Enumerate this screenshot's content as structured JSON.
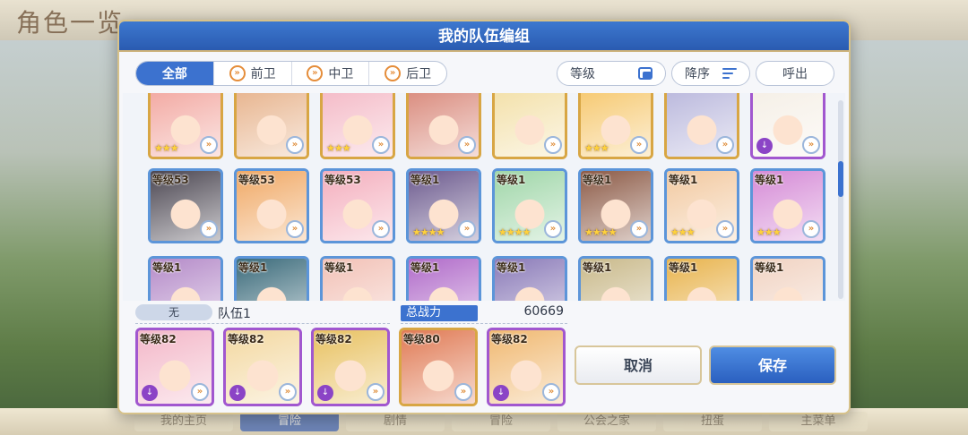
{
  "background": {
    "title": "角色一览",
    "bottom_tabs": [
      "我的主页",
      "冒险",
      "剧情",
      "冒险",
      "公会之家",
      "扭蛋",
      "主菜单"
    ]
  },
  "dialog": {
    "title": "我的队伍编组",
    "filter_tabs": [
      "全部",
      "前卫",
      "中卫",
      "后卫"
    ],
    "sort_field": "等级",
    "sort_order": "降序",
    "call_button": "呼出"
  },
  "grid": [
    {
      "level": "",
      "stars": "★★★",
      "frame": "gold",
      "color": "#f2a7a0"
    },
    {
      "level": "",
      "stars": "",
      "frame": "gold",
      "color": "#e7b38c"
    },
    {
      "level": "",
      "stars": "★★★",
      "frame": "gold",
      "color": "#f4b9c6"
    },
    {
      "level": "",
      "stars": "",
      "frame": "gold",
      "color": "#d9897b"
    },
    {
      "level": "",
      "stars": "",
      "frame": "gold",
      "color": "#f3e0a8"
    },
    {
      "level": "",
      "stars": "★★★",
      "frame": "gold",
      "color": "#f6c86e"
    },
    {
      "level": "",
      "stars": "",
      "frame": "gold",
      "color": "#b9b7dc"
    },
    {
      "level": "",
      "stars": "",
      "frame": "purple",
      "color": "#f5efe6"
    },
    {
      "level": "等级53",
      "stars": "",
      "frame": "blue",
      "color": "#4a4550"
    },
    {
      "level": "等级53",
      "stars": "",
      "frame": "blue",
      "color": "#f0a864"
    },
    {
      "level": "等级53",
      "stars": "",
      "frame": "blue",
      "color": "#f4aebd"
    },
    {
      "level": "等级1",
      "stars": "★★★★",
      "frame": "blue",
      "color": "#6c5a8e"
    },
    {
      "level": "等级1",
      "stars": "★★★★",
      "frame": "blue",
      "color": "#9fd6a8"
    },
    {
      "level": "等级1",
      "stars": "★★★★",
      "frame": "blue",
      "color": "#8c5a46"
    },
    {
      "level": "等级1",
      "stars": "★★★",
      "frame": "blue",
      "color": "#f2c9a0"
    },
    {
      "level": "等级1",
      "stars": "★★★",
      "frame": "blue",
      "color": "#d58ad6"
    },
    {
      "level": "等级1",
      "stars": "",
      "frame": "blue",
      "color": "#b48ac8"
    },
    {
      "level": "等级1",
      "stars": "",
      "frame": "blue",
      "color": "#3a6a7a"
    },
    {
      "level": "等级1",
      "stars": "",
      "frame": "blue",
      "color": "#f2c1b6"
    },
    {
      "level": "等级1",
      "stars": "",
      "frame": "blue",
      "color": "#b06ac9"
    },
    {
      "level": "等级1",
      "stars": "",
      "frame": "blue",
      "color": "#8a7ab8"
    },
    {
      "level": "等级1",
      "stars": "",
      "frame": "blue",
      "color": "#c9b98a"
    },
    {
      "level": "等级1",
      "stars": "",
      "frame": "blue",
      "color": "#e8b34c"
    },
    {
      "level": "等级1",
      "stars": "",
      "frame": "blue",
      "color": "#f1d3c2"
    }
  ],
  "party": {
    "badge": "无",
    "name": "队伍1",
    "power_label": "总战力",
    "power_value": "60669",
    "members": [
      {
        "level": "等级82",
        "frame": "purple",
        "color": "#f3b7c8"
      },
      {
        "level": "等级82",
        "frame": "purple",
        "color": "#f3d8a0"
      },
      {
        "level": "等级82",
        "frame": "purple",
        "color": "#e8c160"
      },
      {
        "level": "等级80",
        "frame": "gold",
        "color": "#e07a54"
      },
      {
        "level": "等级82",
        "frame": "purple",
        "color": "#f0b870"
      }
    ]
  },
  "buttons": {
    "cancel": "取消",
    "save": "保存"
  }
}
